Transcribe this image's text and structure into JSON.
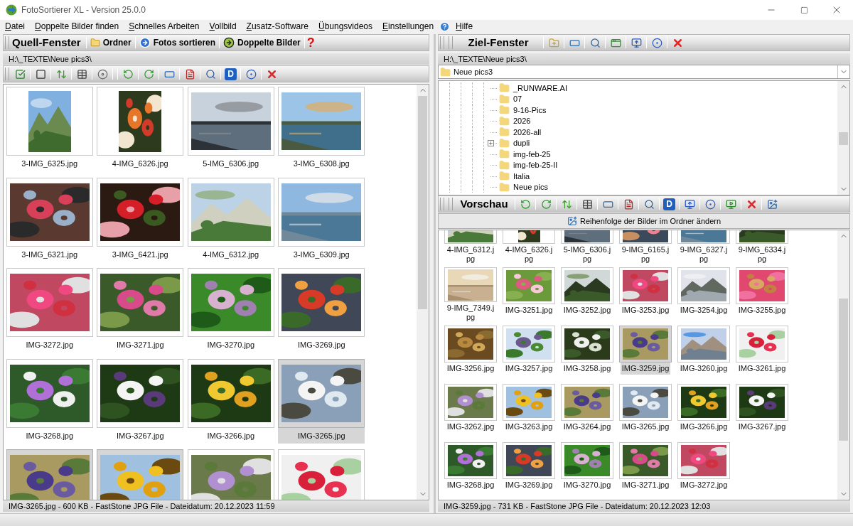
{
  "window": {
    "title": "FotoSortierer XL - Version 25.0.0"
  },
  "menu": [
    {
      "label": "Datei"
    },
    {
      "label": "Doppelte Bilder finden"
    },
    {
      "label": "Schnelles Arbeiten"
    },
    {
      "label": "Vollbild"
    },
    {
      "label": "Zusatz-Software"
    },
    {
      "label": "Übungsvideos"
    },
    {
      "label": "Einstellungen"
    },
    {
      "label": "Hilfe",
      "kind": "help"
    }
  ],
  "source": {
    "title": "Quell-Fenster",
    "buttons": [
      {
        "label": "Ordner",
        "kind": "folder"
      },
      {
        "label": "Fotos sortieren",
        "kind": "sort"
      },
      {
        "label": "Doppelte Bilder",
        "kind": "duplicates"
      }
    ],
    "help_mark": "?",
    "path": "H:\\_TEXTE\\Neue pics3\\",
    "d_label": "D",
    "thumbnails": [
      {
        "name": "3-IMG_6325.jpg",
        "selected": false
      },
      {
        "name": "4-IMG_6326.jpg",
        "selected": false
      },
      {
        "name": "5-IMG_6306.jpg",
        "selected": false
      },
      {
        "name": "3-IMG_6308.jpg",
        "selected": false
      },
      {
        "name": "3-IMG_6321.jpg",
        "selected": false
      },
      {
        "name": "3-IMG_6421.jpg",
        "selected": false
      },
      {
        "name": "4-IMG_6312.jpg",
        "selected": false
      },
      {
        "name": "3-IMG_6309.jpg",
        "selected": false
      },
      {
        "name": "IMG-3272.jpg",
        "selected": false
      },
      {
        "name": "IMG-3271.jpg",
        "selected": false
      },
      {
        "name": "IMG-3270.jpg",
        "selected": false
      },
      {
        "name": "IMG-3269.jpg",
        "selected": false
      },
      {
        "name": "IMG-3268.jpg",
        "selected": false
      },
      {
        "name": "IMG-3267.jpg",
        "selected": false
      },
      {
        "name": "IMG-3266.jpg",
        "selected": false
      },
      {
        "name": "IMG-3265.jpg",
        "selected": true
      },
      {
        "selected": true
      },
      {
        "selected": true
      },
      {
        "selected": false
      },
      {
        "selected": false
      }
    ],
    "status": "IMG-3265.jpg - 600 KB - FastStone JPG File - Dateidatum: 20.12.2023 11:59"
  },
  "target": {
    "title": "Ziel-Fenster",
    "path": "H:\\_TEXTE\\Neue pics3\\",
    "folder_select": "Neue pics3",
    "tree": [
      {
        "label": "_RUNWARE.AI",
        "expandable": false
      },
      {
        "label": "07",
        "expandable": false
      },
      {
        "label": "9-16-Pics",
        "expandable": false
      },
      {
        "label": "2026",
        "expandable": false
      },
      {
        "label": "2026-all",
        "expandable": false
      },
      {
        "label": "dupli",
        "expandable": true
      },
      {
        "label": "img-feb-25",
        "expandable": false
      },
      {
        "label": "img-feb-25-II",
        "expandable": false
      },
      {
        "label": "Italia",
        "expandable": false
      },
      {
        "label": "Neue pics",
        "expandable": false
      }
    ]
  },
  "preview": {
    "title": "Vorschau",
    "d_label": "D",
    "reorder_button": "Reihenfolge der Bilder im Ordner ändern",
    "thumbnails": [
      {
        "name": "4-IMG_6312.jpg",
        "selected": false
      },
      {
        "name": "4-IMG_6326.jpg",
        "selected": false
      },
      {
        "name": "5-IMG_6306.jpg",
        "selected": false
      },
      {
        "name": "9-IMG_6165.jpg",
        "selected": false
      },
      {
        "name": "9-IMG_6327.jpg",
        "selected": false
      },
      {
        "name": "9-IMG_6334.jpg",
        "selected": false
      },
      {
        "name": "9-IMG_7349.jpg",
        "selected": false
      },
      {
        "name": "IMG-3251.jpg",
        "selected": false
      },
      {
        "name": "IMG-3252.jpg",
        "selected": false
      },
      {
        "name": "IMG-3253.jpg",
        "selected": false
      },
      {
        "name": "IMG-3254.jpg",
        "selected": false
      },
      {
        "name": "IMG-3255.jpg",
        "selected": false
      },
      {
        "name": "IMG-3256.jpg",
        "selected": false
      },
      {
        "name": "IMG-3257.jpg",
        "selected": false
      },
      {
        "name": "IMG-3258.jpg",
        "selected": false
      },
      {
        "name": "IMG-3259.jpg",
        "selected": true
      },
      {
        "name": "IMG-3260.jpg",
        "selected": false
      },
      {
        "name": "IMG-3261.jpg",
        "selected": false
      },
      {
        "name": "IMG-3262.jpg",
        "selected": false
      },
      {
        "name": "IMG-3263.jpg",
        "selected": false
      },
      {
        "name": "IMG-3264.jpg",
        "selected": false
      },
      {
        "name": "IMG-3265.jpg",
        "selected": false
      },
      {
        "name": "IMG-3266.jpg",
        "selected": false
      },
      {
        "name": "IMG-3267.jpg",
        "selected": false
      },
      {
        "name": "IMG-3268.jpg",
        "selected": false
      },
      {
        "name": "IMG-3269.jpg",
        "selected": false
      },
      {
        "name": "IMG-3270.jpg",
        "selected": false
      },
      {
        "name": "IMG-3271.jpg",
        "selected": false
      },
      {
        "name": "IMG-3272.jpg",
        "selected": false
      }
    ],
    "status": "IMG-3259.jpg - 731 KB - FastStone JPG File - Dateidatum: 20.12.2023 12:03"
  }
}
